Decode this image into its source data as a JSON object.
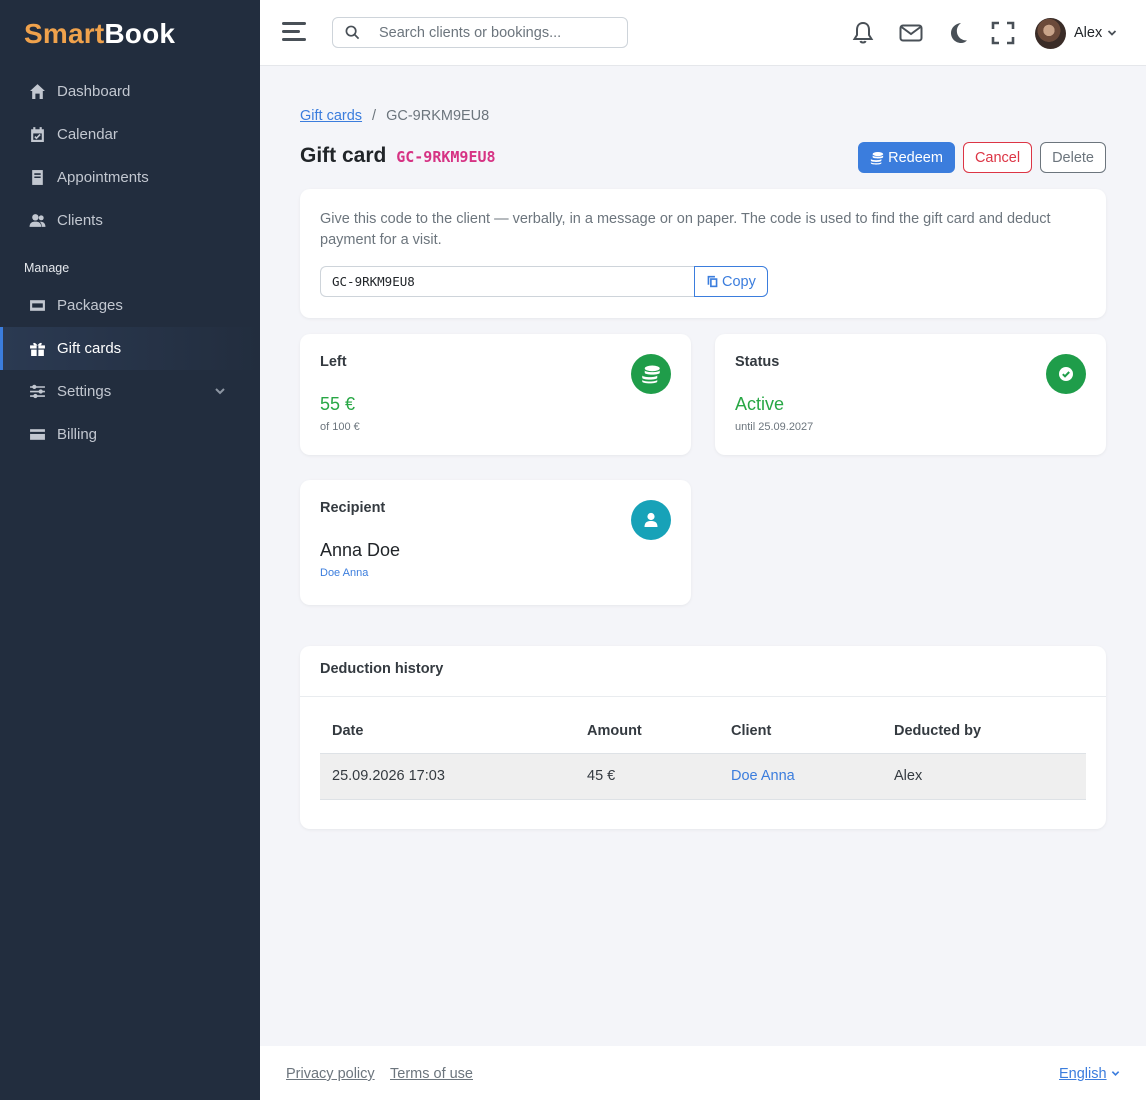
{
  "brand": {
    "part1": "Smart",
    "part2": "Book"
  },
  "sidebar": {
    "items": [
      {
        "label": "Dashboard",
        "icon": "home-icon"
      },
      {
        "label": "Calendar",
        "icon": "calendar-icon"
      },
      {
        "label": "Appointments",
        "icon": "book-icon"
      },
      {
        "label": "Clients",
        "icon": "users-icon"
      }
    ],
    "section_label": "Manage",
    "manage_items": [
      {
        "label": "Packages",
        "icon": "ticket-icon"
      },
      {
        "label": "Gift cards",
        "icon": "gift-icon",
        "active": true
      },
      {
        "label": "Settings",
        "icon": "sliders-icon",
        "has_submenu": true
      },
      {
        "label": "Billing",
        "icon": "credit-card-icon"
      }
    ]
  },
  "topbar": {
    "search_placeholder": "Search clients or bookings...",
    "user_name": "Alex"
  },
  "breadcrumb": {
    "parent": "Gift cards",
    "current": "GC-9RKM9EU8"
  },
  "page": {
    "title": "Gift card",
    "code": "GC-9RKM9EU8"
  },
  "actions": {
    "redeem": "Redeem",
    "cancel": "Cancel",
    "delete": "Delete"
  },
  "code_card": {
    "description": "Give this code to the client — verbally, in a message or on paper. The code is used to find the gift card and deduct payment for a visit.",
    "code_value": "GC-9RKM9EU8",
    "copy_label": "Copy"
  },
  "stats": {
    "left": {
      "label": "Left",
      "value": "55 €",
      "sub": "of 100 €"
    },
    "status": {
      "label": "Status",
      "value": "Active",
      "sub": "until 25.09.2027"
    },
    "recipient": {
      "label": "Recipient",
      "value": "Anna Doe",
      "sub": "Doe Anna"
    }
  },
  "history": {
    "title": "Deduction history",
    "columns": [
      "Date",
      "Amount",
      "Client",
      "Deducted by"
    ],
    "rows": [
      {
        "date": "25.09.2026 17:03",
        "amount": "45 €",
        "client": "Doe Anna",
        "by": "Alex"
      }
    ]
  },
  "footer": {
    "privacy": "Privacy policy",
    "terms": "Terms of use",
    "language": "English"
  },
  "colors": {
    "sidebar_bg": "#222d3e",
    "brand_accent": "#f0a24c",
    "primary": "#3b7ddd",
    "success": "#28a745",
    "danger": "#dc3545",
    "code_pink": "#d63384",
    "teal": "#17a2b8"
  }
}
